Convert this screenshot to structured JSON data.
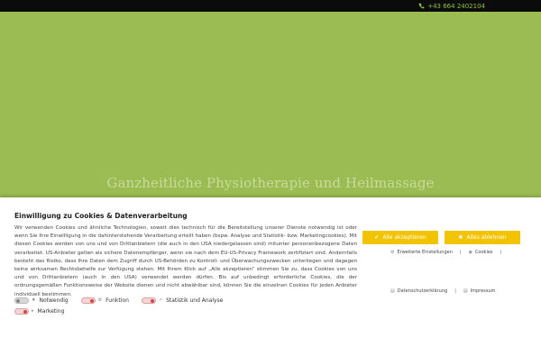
{
  "topbar": {
    "phone": "+43 664 2402104"
  },
  "hero": {
    "title": "Ganzheitliche Physiotherapie und Heilmassage"
  },
  "consent": {
    "title": "Einwilligung zu Cookies & Datenverarbeitung",
    "text": "Wir verwenden Cookies und ähnliche Technologien, soweit dies technisch für die Bereitstellung unserer Dienste notwendig ist oder wenn Sie Ihre Einwilligung in die dahinterstehende Verarbeitung erteilt haben (bspw. Analyse und Statistik- bzw. Marketingcookies). Mit diesen Cookies werden von uns und von Drittanbietern (die auch in den USA niedergelassen sind) mitunter personenbezogene Daten verarbeitet. US-Anbieter gelten als sichere Datenempfänger, wenn sie nach dem EU-US-Privacy Framework zertifiziert sind. Andernfalls besteht das Risiko, dass Ihre Daten dem Zugriff durch US-Behörden zu Kontroll- und Überwachungszwecken unterliegen und dagegen keine wirksamen Rechtsbehelfe zur Verfügung stehen. Mit Ihrem Klick auf „Alle akzeptieren“ stimmen Sie zu, dass Cookies von uns und von Drittanbietern (auch in den USA) verwendet werden dürfen. Bis auf unbedingt erforderliche Cookies, die der ordnungsgemäßen Funktionsweise der Website dienen und nicht abwählbar sind, können Sie die einzelnen Cookies für jeden Anbieter individuell bestimmen.",
    "options": {
      "notwendig": "Notwendig",
      "funktion": "Funktion",
      "statistik": "Statistik und Analyse",
      "marketing": "Marketing"
    },
    "accept_label": "Alle akzeptieren",
    "reject_label": "Alles ablehnen",
    "links": {
      "settings": "Erweiterte Einstellungen",
      "cookies": "Cookies",
      "privacy": "Datenschutzerklärung",
      "imprint": "Impressum"
    }
  },
  "colors": {
    "hero_green": "#9bbc52",
    "accent_yellow": "#f2c400",
    "phone_green": "#8cc63f",
    "toggle_red": "#d64545"
  }
}
